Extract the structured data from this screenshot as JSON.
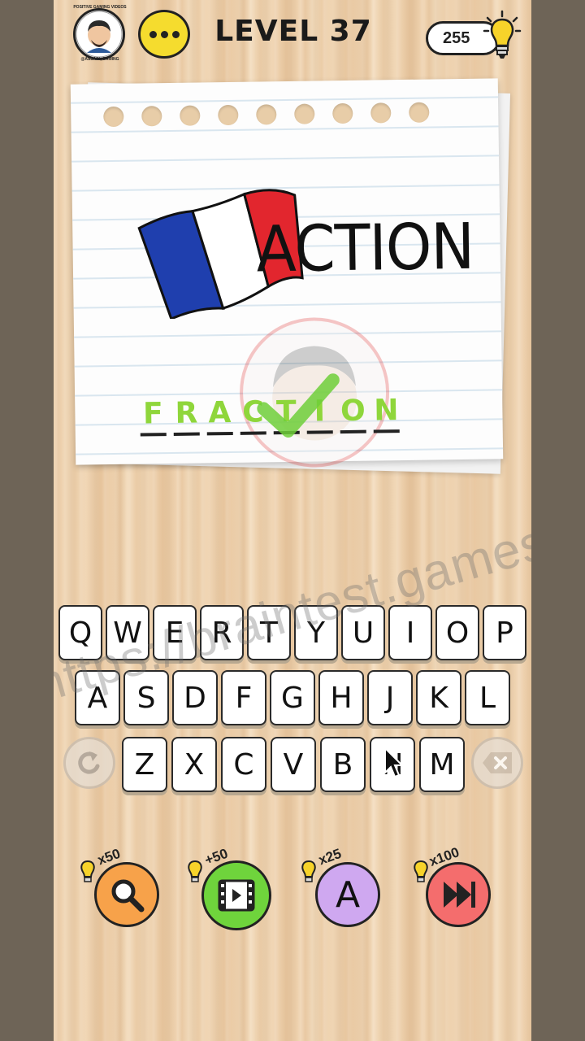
{
  "header": {
    "level_label": "LEVEL 37",
    "hint_count": "255",
    "channel_name_top": "POSITIVE GAMING VIDEOS",
    "channel_name_bottom": "@ASSAIN_GAMING"
  },
  "puzzle": {
    "word": "ACTION",
    "answer_letters": [
      "F",
      "R",
      "A",
      "C",
      "T",
      "I",
      "O",
      "N"
    ]
  },
  "keyboard": {
    "row1": [
      "Q",
      "W",
      "E",
      "R",
      "T",
      "Y",
      "U",
      "I",
      "O",
      "P"
    ],
    "row2": [
      "A",
      "S",
      "D",
      "F",
      "G",
      "H",
      "J",
      "K",
      "L"
    ],
    "row3": [
      "Z",
      "X",
      "C",
      "V",
      "B",
      "N",
      "M"
    ]
  },
  "powerups": [
    {
      "name": "magnifier-icon",
      "cost": "x50",
      "color": "#f7a24a"
    },
    {
      "name": "video-icon",
      "cost": "+50",
      "color": "#6fd43c"
    },
    {
      "name": "letter-icon",
      "cost": "x25",
      "color": "#cfa8f0",
      "letter": "A"
    },
    {
      "name": "skip-icon",
      "cost": "x100",
      "color": "#f46d6d"
    }
  ],
  "watermark_url": "https://braintest.games",
  "colors": {
    "answer_green": "#8fd63b",
    "menu_yellow": "#f5dc2e",
    "flag_blue": "#1f3fae",
    "flag_red": "#e2262e"
  }
}
